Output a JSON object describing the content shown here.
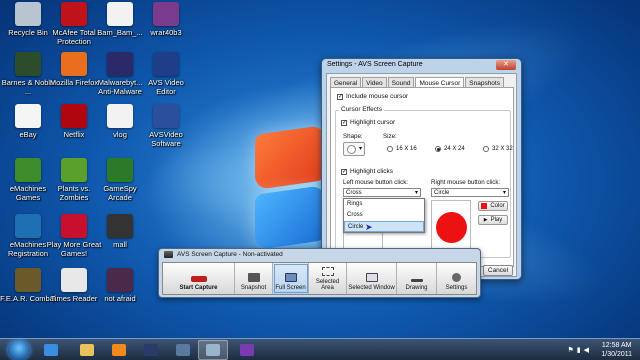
{
  "desktop": {
    "icons": [
      {
        "label": "Recycle Bin",
        "icon": "recycle-bin-icon",
        "color": "#b8c4d0"
      },
      {
        "label": "McAfee Total Protection",
        "icon": "mcafee-icon",
        "color": "#c0121b"
      },
      {
        "label": "Bam_Bam_...",
        "icon": "document-icon",
        "color": "#f2f2f2"
      },
      {
        "label": "wrar40b3",
        "icon": "winrar-icon",
        "color": "#7a3b8c"
      },
      {
        "label": "Barnes & Noble ...",
        "icon": "barnes-noble-icon",
        "color": "#2c4d2c"
      },
      {
        "label": "Mozilla Firefox",
        "icon": "firefox-icon",
        "color": "#e76f1e"
      },
      {
        "label": "Malwarebyt... Anti-Malware",
        "icon": "malwarebytes-icon",
        "color": "#2a2a6a"
      },
      {
        "label": "AVS Video Editor",
        "icon": "avs-video-icon",
        "color": "#1d3f8a"
      },
      {
        "label": "eBay",
        "icon": "ebay-icon",
        "color": "#f5f5f5"
      },
      {
        "label": "Netflix",
        "icon": "netflix-icon",
        "color": "#b0060f"
      },
      {
        "label": "vlog",
        "icon": "document-icon",
        "color": "#f2f2f2"
      },
      {
        "label": "AVSVideo Software",
        "icon": "avs-software-icon",
        "color": "#2b4f9c"
      },
      {
        "label": "eMachines Games",
        "icon": "games-icon",
        "color": "#3c8c2c"
      },
      {
        "label": "Plants vs. Zombies",
        "icon": "plants-zombies-icon",
        "color": "#5aa02c"
      },
      {
        "label": "GameSpy Arcade",
        "icon": "gamespy-icon",
        "color": "#2a7a2a"
      },
      {
        "label": "eMachines Registration",
        "icon": "registration-icon",
        "color": "#1f6fb5"
      },
      {
        "label": "Play More Great Games!",
        "icon": "play-games-icon",
        "color": "#c8102e"
      },
      {
        "label": "mall",
        "icon": "video-file-icon",
        "color": "#333333"
      },
      {
        "label": "F.E.A.R. Combat",
        "icon": "fear-combat-icon",
        "color": "#6a5a2a"
      },
      {
        "label": "Times Reader",
        "icon": "times-reader-icon",
        "color": "#e8e8e8"
      },
      {
        "label": "not afraid",
        "icon": "video-file-icon",
        "color": "#4a2a4a"
      }
    ]
  },
  "settings": {
    "title": "Settings - AVS Screen Capture",
    "tabs": [
      "General",
      "Video",
      "Sound",
      "Mouse Cursor",
      "Snapshots"
    ],
    "active_tab": "Mouse Cursor",
    "include_mouse_cursor": "Include mouse cursor",
    "cursor_effects": "Cursor Effects",
    "highlight_cursor": "Highlight cursor",
    "shape_label": "Shape:",
    "size_label": "Size:",
    "sizes": [
      "16 X 16",
      "24 X 24",
      "32 X 32"
    ],
    "selected_size": "24 X 24",
    "highlight_clicks": "Highlight clicks",
    "left_click_label": "Left mouse button click:",
    "right_click_label": "Right mouse button click:",
    "left_value": "Cross",
    "right_value": "Circle",
    "dropdown_options": [
      "Rings",
      "Cross",
      "Circle"
    ],
    "dropdown_highlight": "Circle",
    "color_button": "Color",
    "play_button": "Play",
    "ok_button": "OK",
    "cancel_button": "Cancel",
    "color_swatch": "#e8141c",
    "preview_circle": "#ee1111"
  },
  "avs": {
    "title": "AVS Screen Capture - Non-activated",
    "tools": [
      "Start Capture",
      "Snapshot",
      "Full Screen",
      "Selected Area",
      "Selected Window",
      "Drawing",
      "Settings"
    ],
    "selected_tool": "Full Screen"
  },
  "taskbar": {
    "time": "12:58 AM",
    "date": "1/30/2011",
    "items": [
      {
        "icon": "internet-explorer-icon",
        "color": "#3b8de0"
      },
      {
        "icon": "file-explorer-icon",
        "color": "#e8c25a"
      },
      {
        "icon": "media-player-icon",
        "color": "#f08a1c"
      },
      {
        "icon": "avs-editor-icon",
        "color": "#2a3b6a"
      },
      {
        "icon": "avs-capture-icon",
        "color": "#5a7aa0"
      },
      {
        "icon": "monitor-icon",
        "color": "#9ab4cc"
      },
      {
        "icon": "video-strip-icon",
        "color": "#7a3bb0"
      }
    ],
    "active_index": 5
  }
}
